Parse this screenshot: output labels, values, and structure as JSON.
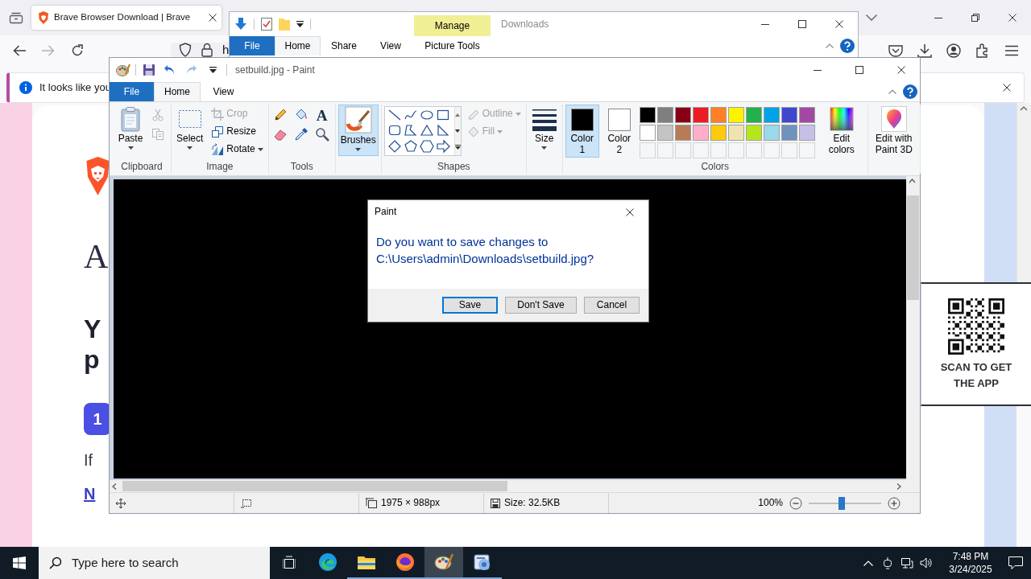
{
  "browser": {
    "tab": {
      "title": "Brave Browser Download | Brave"
    },
    "address": {
      "text": "h"
    },
    "notice": {
      "text": "It looks like you"
    },
    "page": {
      "heading": "A",
      "subheading_lines": [
        "Y",
        "p"
      ],
      "step": "1",
      "paragraph": "If",
      "link": "N",
      "qr_caption": "SCAN TO GET THE APP"
    }
  },
  "explorer": {
    "title": "Downloads",
    "context_header": "Manage",
    "tabs": [
      {
        "label": "File",
        "kind": "file",
        "selected": false
      },
      {
        "label": "Home",
        "kind": "tab",
        "selected": true
      },
      {
        "label": "Share",
        "kind": "tab",
        "selected": false
      },
      {
        "label": "View",
        "kind": "tab",
        "selected": false
      },
      {
        "label": "Picture Tools",
        "kind": "context",
        "selected": false
      }
    ]
  },
  "paint": {
    "title": "setbuild.jpg - Paint",
    "quick_access": [
      {
        "disabled": false
      },
      {
        "disabled": false
      },
      {
        "disabled": true
      }
    ],
    "tabs": [
      {
        "label": "File",
        "kind": "file",
        "selected": false
      },
      {
        "label": "Home",
        "kind": "tab",
        "selected": true
      },
      {
        "label": "View",
        "kind": "tab",
        "selected": false
      }
    ],
    "groups": [
      {
        "label": "Clipboard",
        "items": [
          {
            "kind": "large",
            "label": "Paste",
            "dropdown": true,
            "disabled": false,
            "selected": false
          },
          {
            "kind": "icon",
            "disabled": true,
            "selected": false
          },
          {
            "kind": "icon",
            "disabled": true,
            "selected": false
          }
        ]
      },
      {
        "label": "Image",
        "items": [
          {
            "kind": "large",
            "label": "Select",
            "dropdown": true,
            "disabled": false,
            "selected": false
          },
          {
            "kind": "small",
            "label": "Crop",
            "dropdown": false,
            "disabled": true,
            "selected": false
          },
          {
            "kind": "small",
            "label": "Resize",
            "dropdown": false,
            "disabled": false,
            "selected": false
          },
          {
            "kind": "small",
            "label": "Rotate",
            "dropdown": true,
            "disabled": false,
            "selected": false
          }
        ]
      },
      {
        "label": "Tools",
        "items": [
          {
            "kind": "icon",
            "disabled": false,
            "selected": false
          },
          {
            "kind": "icon",
            "disabled": false,
            "selected": false
          },
          {
            "kind": "icon",
            "glyph": "A",
            "disabled": false,
            "selected": false
          },
          {
            "kind": "icon",
            "disabled": false,
            "selected": false
          },
          {
            "kind": "icon",
            "disabled": false,
            "selected": false
          },
          {
            "kind": "icon",
            "disabled": false,
            "selected": false
          }
        ]
      },
      {
        "items": [
          {
            "kind": "large",
            "label": "Brushes",
            "dropdown": true,
            "disabled": false,
            "selected": true
          }
        ]
      },
      {
        "label": "Shapes",
        "items": [
          {
            "kind": "gallery"
          },
          {
            "kind": "small",
            "label": "Outline",
            "dropdown": true,
            "disabled": true,
            "selected": false
          },
          {
            "kind": "small",
            "label": "Fill",
            "dropdown": true,
            "disabled": true,
            "selected": false
          }
        ]
      },
      {
        "items": [
          {
            "kind": "large",
            "label": "Size",
            "dropdown": true,
            "disabled": false,
            "selected": false
          }
        ]
      },
      {
        "label": "Colors",
        "items": [
          {
            "kind": "color",
            "label": "Color 1",
            "color": "#000000",
            "disabled": false,
            "selected": true
          },
          {
            "kind": "color",
            "label": "Color 2",
            "color": "#ffffff",
            "disabled": false,
            "selected": false
          },
          {
            "kind": "palette",
            "swatches": [
              {
                "color": "#000000"
              },
              {
                "color": "#7f7f7f"
              },
              {
                "color": "#880015"
              },
              {
                "color": "#ed1c24"
              },
              {
                "color": "#ff7f27"
              },
              {
                "color": "#fff200"
              },
              {
                "color": "#22b14c"
              },
              {
                "color": "#00a2e8"
              },
              {
                "color": "#3f48cc"
              },
              {
                "color": "#a349a4"
              },
              {
                "color": "#ffffff"
              },
              {
                "color": "#c3c3c3"
              },
              {
                "color": "#b97a57"
              },
              {
                "color": "#ffaec9"
              },
              {
                "color": "#ffc90e"
              },
              {
                "color": "#efe4b0"
              },
              {
                "color": "#b5e61d"
              },
              {
                "color": "#99d9ea"
              },
              {
                "color": "#7092be"
              },
              {
                "color": "#c8bfe7"
              }
            ]
          },
          {
            "kind": "large",
            "label": "Edit colors",
            "dropdown": false,
            "disabled": false,
            "selected": false
          }
        ]
      },
      {
        "items": [
          {
            "kind": "large",
            "label": "Edit with Paint 3D",
            "dropdown": false,
            "disabled": false,
            "selected": false
          }
        ]
      }
    ],
    "status": {
      "dimensions": "1975 × 988px",
      "file_size": "Size: 32.5KB",
      "zoom": "100%",
      "zoom_slider": {
        "level": 0.45
      }
    }
  },
  "dialog": {
    "title": "Paint",
    "message": "Do you want to save changes to C:\\Users\\admin\\Downloads\\setbuild.jpg?",
    "buttons": [
      {
        "label": "Save",
        "selected": true
      },
      {
        "label": "Don't Save",
        "selected": false
      },
      {
        "label": "Cancel",
        "selected": false
      }
    ]
  },
  "taskbar": {
    "search": {
      "placeholder": "Type here to search"
    },
    "apps": [
      {
        "open": false,
        "selected": false
      },
      {
        "open": false,
        "selected": false
      },
      {
        "open": true,
        "selected": false
      },
      {
        "open": true,
        "selected": false
      },
      {
        "open": true,
        "selected": true
      },
      {
        "open": true,
        "selected": false
      }
    ],
    "clock": {
      "time": "7:48 PM",
      "date": "3/24/2025"
    }
  }
}
